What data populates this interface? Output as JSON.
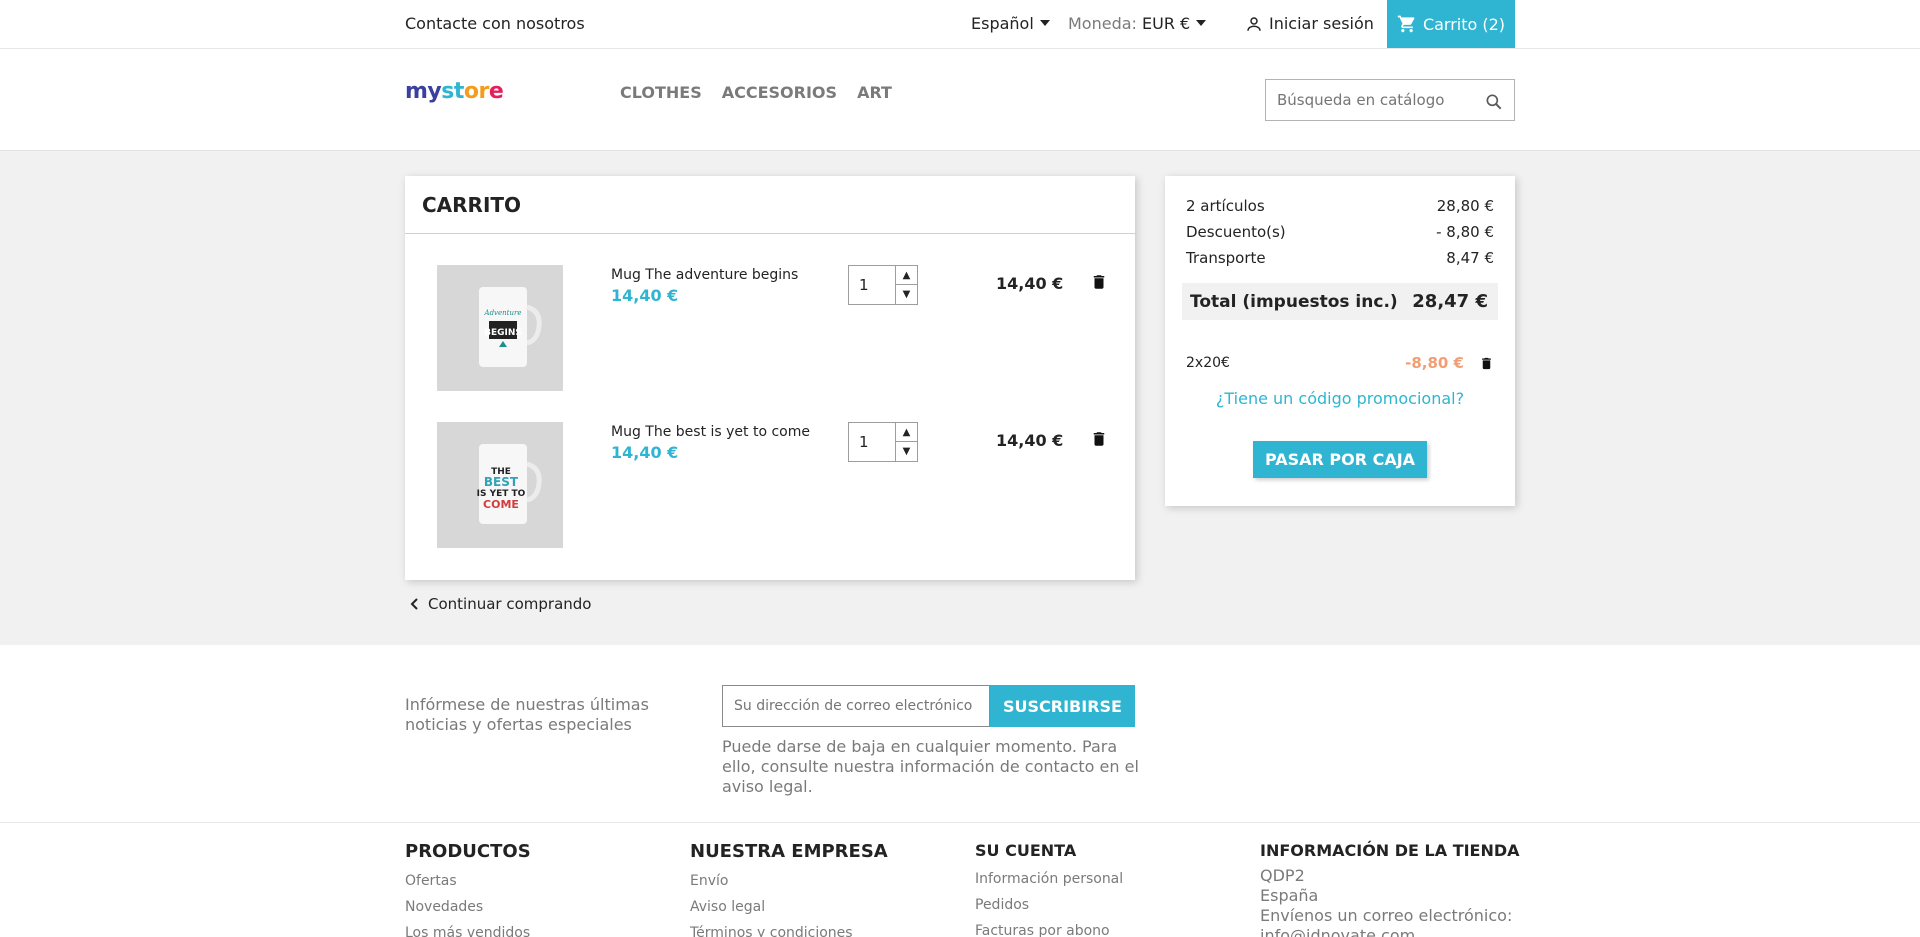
{
  "topbar": {
    "contact": "Contacte con nosotros",
    "language": "Español",
    "currency_label": "Moneda:",
    "currency_value": "EUR €",
    "login": "Iniciar sesión",
    "cart": "Carrito (2)"
  },
  "header": {
    "logo": {
      "part1": "my",
      "part2": "st",
      "part3": "or",
      "part4": "e"
    },
    "menu": [
      "Clothes",
      "Accesorios",
      "Art"
    ],
    "search_placeholder": "Búsqueda en catálogo"
  },
  "cart": {
    "title": "Carrito",
    "items": [
      {
        "name": "Mug The adventure begins",
        "price": "14,40 €",
        "qty": "1",
        "total": "14,40 €",
        "image": "mug-adventure-begins"
      },
      {
        "name": "Mug The best is yet to come",
        "price": "14,40 €",
        "qty": "1",
        "total": "14,40 €",
        "image": "mug-best-yet-to-come"
      }
    ],
    "continue": "Continuar comprando"
  },
  "summary": {
    "articles_label": "2 artículos",
    "articles_value": "28,80 €",
    "discount_label": "Descuento(s)",
    "discount_value": "- 8,80 €",
    "shipping_label": "Transporte",
    "shipping_value": "8,47 €",
    "total_label": "Total (impuestos inc.)",
    "total_value": "28,47 €",
    "voucher_name": "2x20€",
    "voucher_value": "-8,80 €",
    "promo_link": "¿Tiene un código promocional?",
    "checkout": "Pasar por caja"
  },
  "newsletter": {
    "text": "Infórmese de nuestras últimas noticias y ofertas especiales",
    "placeholder": "Su dirección de correo electrónico",
    "button": "Suscribirse",
    "note": "Puede darse de baja en cualquier momento. Para ello, consulte nuestra información de contacto en el aviso legal."
  },
  "footer": {
    "products": {
      "title": "Productos",
      "links": [
        "Ofertas",
        "Novedades",
        "Los más vendidos"
      ]
    },
    "company": {
      "title": "Nuestra empresa",
      "links": [
        "Envío",
        "Aviso legal",
        "Términos y condiciones"
      ]
    },
    "account": {
      "title": "Su cuenta",
      "links": [
        "Información personal",
        "Pedidos",
        "Facturas por abono"
      ]
    },
    "store": {
      "title": "Información de la tienda",
      "lines": [
        "QDP2",
        "España",
        "Envíenos un correo electrónico:",
        "info@idnovate.com"
      ]
    }
  },
  "colors": {
    "accent": "#2fb5d2",
    "discount": "#f39d72",
    "background": "#f1f1f1"
  }
}
